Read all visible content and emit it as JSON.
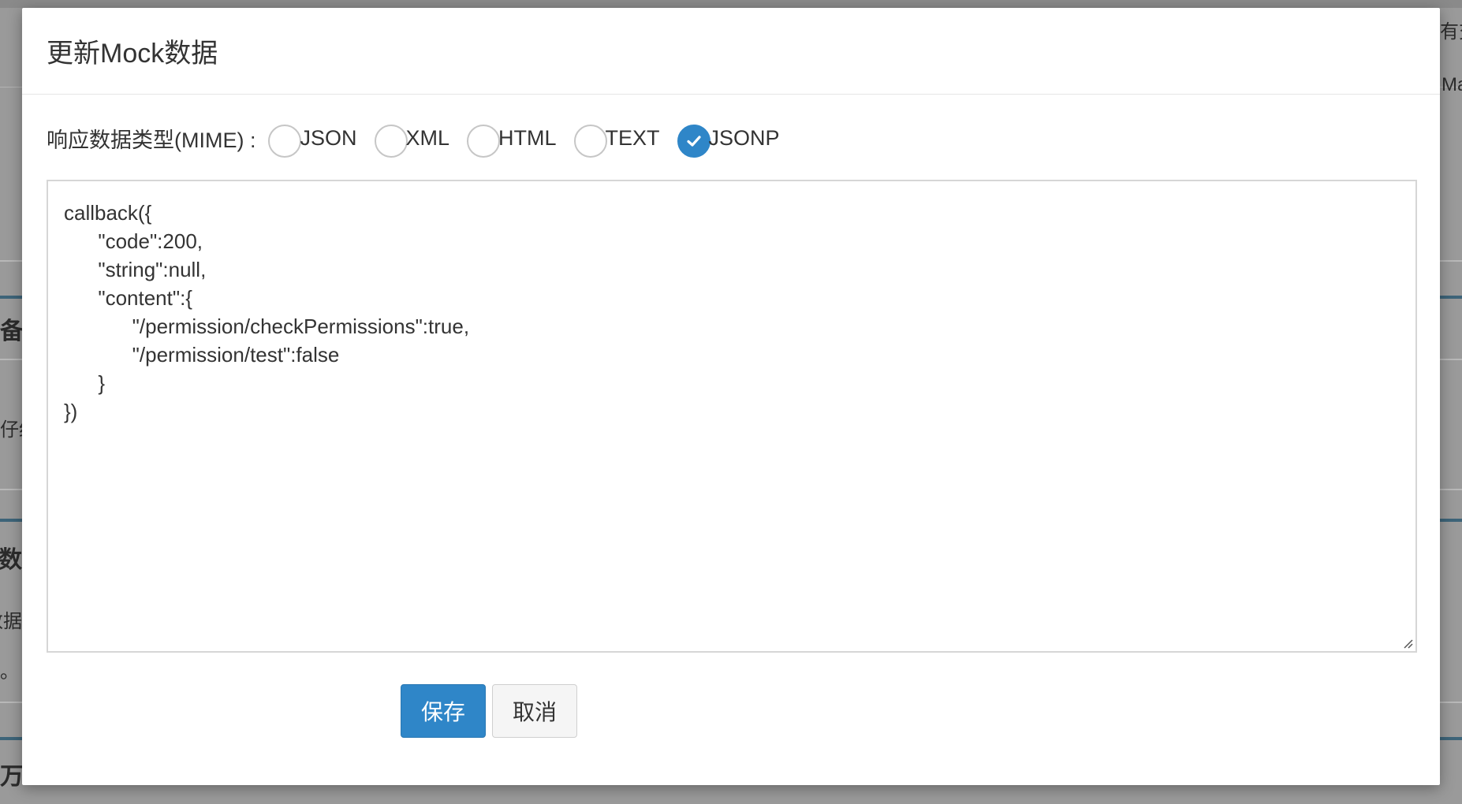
{
  "background": {
    "fragments": [
      "有交",
      "Ma",
      "备",
      "仔细",
      "k数",
      "数据",
      "。",
      "万"
    ]
  },
  "modal": {
    "title": "更新Mock数据",
    "mime_label": "响应数据类型(MIME) :",
    "options": [
      {
        "label": "JSON",
        "checked": false
      },
      {
        "label": "XML",
        "checked": false
      },
      {
        "label": "HTML",
        "checked": false
      },
      {
        "label": "TEXT",
        "checked": false
      },
      {
        "label": "JSONP",
        "checked": true
      }
    ],
    "editor_content": "callback({\n      \"code\":200,\n      \"string\":null,\n      \"content\":{\n            \"/permission/checkPermissions\":true,\n            \"/permission/test\":false\n      }\n})",
    "save_label": "保存",
    "cancel_label": "取消"
  },
  "colors": {
    "accent": "#2f86c8",
    "overlay": "#9a9a9a"
  }
}
